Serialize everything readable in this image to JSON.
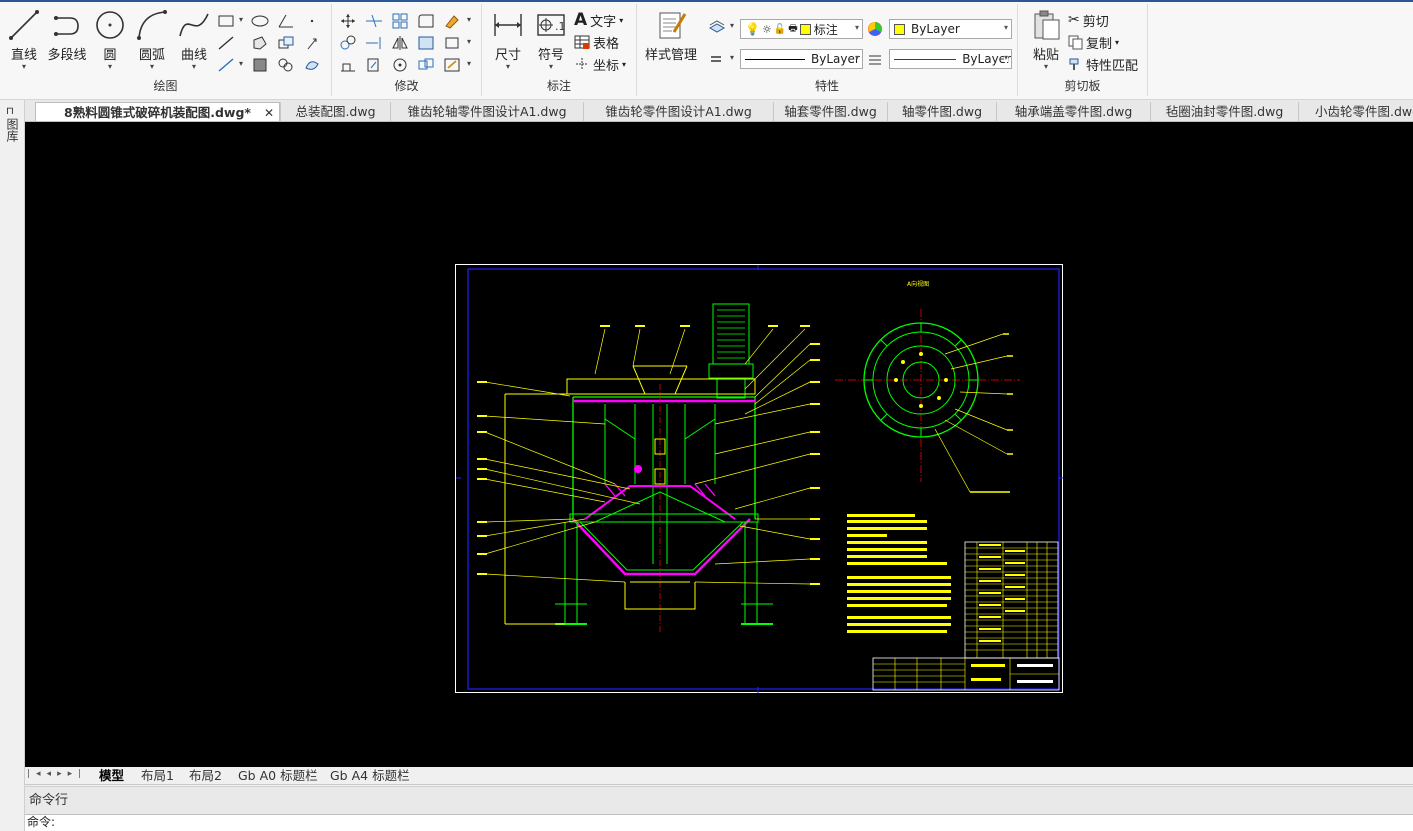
{
  "ribbon": {
    "groups": {
      "draw": "绘图",
      "modify": "修改",
      "annotate": "标注",
      "properties": "特性",
      "clipboard": "剪切板"
    },
    "draw": {
      "line": "直线",
      "polyline": "多段线",
      "circle": "圆",
      "arc": "圆弧",
      "curve": "曲线"
    },
    "annotate": {
      "dimension": "尺寸",
      "symbol": "符号",
      "text": "文字",
      "table": "表格",
      "coordinate": "坐标"
    },
    "properties": {
      "style_manager": "样式管理",
      "layer_name": "标注",
      "color_value": "ByLayer",
      "linetype_value": "ByLayer",
      "lineweight_value": "ByLayer",
      "color_swatch": "#ffff00",
      "line_red": "#cc0000"
    },
    "clipboard": {
      "paste": "粘贴",
      "cut": "剪切",
      "copy": "复制",
      "match_properties": "特性匹配"
    }
  },
  "sidepanel": {
    "tab_label": "图库"
  },
  "doctabs": [
    {
      "label": "8熟料圆锥式破碎机装配图.dwg*",
      "active": true
    },
    {
      "label": "总装配图.dwg",
      "active": false
    },
    {
      "label": "锥齿轮轴零件图设计A1.dwg",
      "active": false
    },
    {
      "label": "锥齿轮零件图设计A1.dwg",
      "active": false
    },
    {
      "label": "轴套零件图.dwg",
      "active": false
    },
    {
      "label": "轴零件图.dwg",
      "active": false
    },
    {
      "label": "轴承端盖零件图.dwg",
      "active": false
    },
    {
      "label": "毡圈油封零件图.dwg",
      "active": false
    },
    {
      "label": "小齿轮零件图.dwg",
      "active": false
    }
  ],
  "drawing": {
    "view_label": "A向视图"
  },
  "layout_tabs": [
    {
      "label": "模型",
      "active": true
    },
    {
      "label": "布局1",
      "active": false
    },
    {
      "label": "布局2",
      "active": false
    },
    {
      "label": "Gb A0 标题栏",
      "active": false
    },
    {
      "label": "Gb A4 标题栏",
      "active": false
    }
  ],
  "command": {
    "header": "命令行",
    "prompt": "命令:"
  },
  "colors": {
    "canvas": "#000000",
    "drawing_green": "#00ff00",
    "drawing_yellow": "#ffff00",
    "drawing_magenta": "#ff00ff",
    "drawing_blue": "#0000ff",
    "drawing_red": "#ff0000"
  }
}
